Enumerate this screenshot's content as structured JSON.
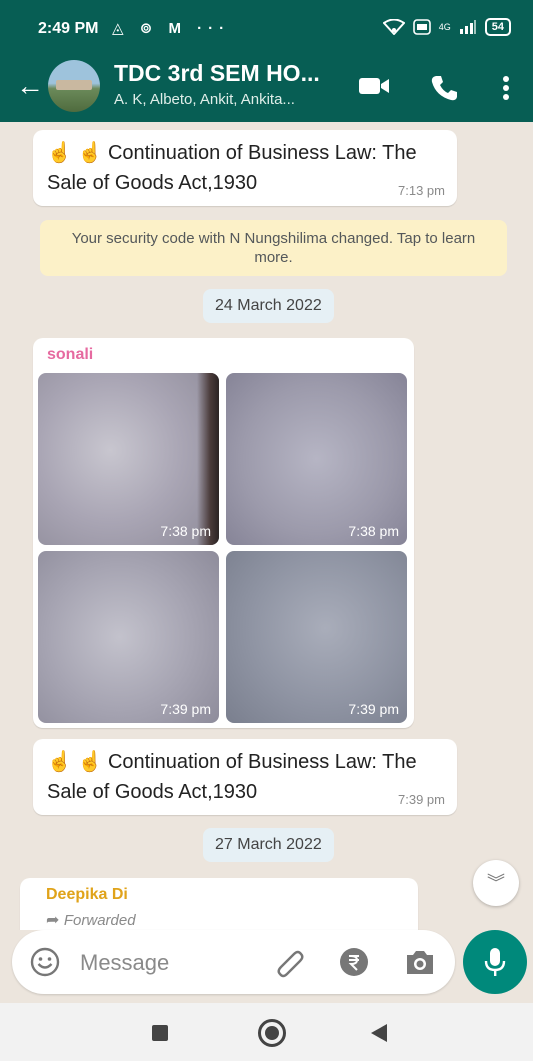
{
  "status_bar": {
    "time": "2:49 PM",
    "notification_icons": "◬ ⊚ M ···",
    "battery": "54",
    "network": "4G"
  },
  "header": {
    "title": "TDC 3rd SEM HO...",
    "subtitle": "A. K, Albeto, Ankit, Ankita..."
  },
  "messages": {
    "top": {
      "emoji": "☝️ ☝️",
      "text_line1": "Continuation of Business Law: The",
      "text_line2": "Sale of Goods Act,1930",
      "time": "7:13 pm"
    },
    "system_note": "Your security code with N Nungshilima changed. Tap to learn more.",
    "date1": "24 March 2022",
    "sonali": {
      "sender": "sonali",
      "photo_times": [
        "7:38 pm",
        "7:38 pm",
        "7:39 pm",
        "7:39 pm"
      ]
    },
    "second": {
      "emoji": "☝️ ☝️",
      "text_line1": "Continuation of Business Law: The",
      "text_line2": "Sale of Goods Act,1930",
      "time": "7:39 pm"
    },
    "date2": "27 March 2022",
    "deepika": {
      "sender": "Deepika Di",
      "forwarded": "Forwarded"
    }
  },
  "composer": {
    "placeholder": "Message"
  },
  "colors": {
    "header": "#075e54",
    "accent": "#00897b",
    "sonali_name": "#e66aa0",
    "deepika_name": "#e0a31a"
  },
  "icons": [
    "back-arrow-icon",
    "video-call-icon",
    "voice-call-icon",
    "more-vert-icon",
    "emoji-icon",
    "attach-icon",
    "rupee-icon",
    "camera-icon",
    "mic-icon",
    "scroll-down-icon"
  ]
}
